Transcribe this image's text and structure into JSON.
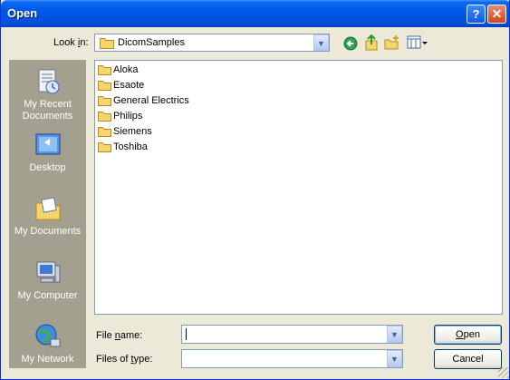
{
  "window": {
    "title": "Open",
    "help_label": "?",
    "close_label": "✕"
  },
  "lookin": {
    "label_prefix": "Look ",
    "label_key": "i",
    "label_suffix": "n:",
    "value": "DicomSamples"
  },
  "places": [
    {
      "label": "My Recent Documents",
      "icon": "recent-documents-icon"
    },
    {
      "label": "Desktop",
      "icon": "desktop-icon"
    },
    {
      "label": "My Documents",
      "icon": "my-documents-icon"
    },
    {
      "label": "My Computer",
      "icon": "my-computer-icon"
    },
    {
      "label": "My Network",
      "icon": "my-network-icon"
    }
  ],
  "files": [
    "Aloka",
    "Esaote",
    "General Electrics",
    "Philips",
    "Siemens",
    "Toshiba"
  ],
  "filename": {
    "label_prefix": "File ",
    "label_key": "n",
    "label_suffix": "ame:",
    "value": ""
  },
  "filetype": {
    "label_prefix": "Files of ",
    "label_key": "t",
    "label_suffix": "ype:",
    "value": ""
  },
  "buttons": {
    "open_key": "O",
    "open_rest": "pen",
    "cancel": "Cancel"
  },
  "colors": {
    "title_bar": "#0054e3",
    "dialog_bg": "#ece9d8",
    "places_bar": "#a3a08f",
    "folder": "#f5d66c"
  }
}
